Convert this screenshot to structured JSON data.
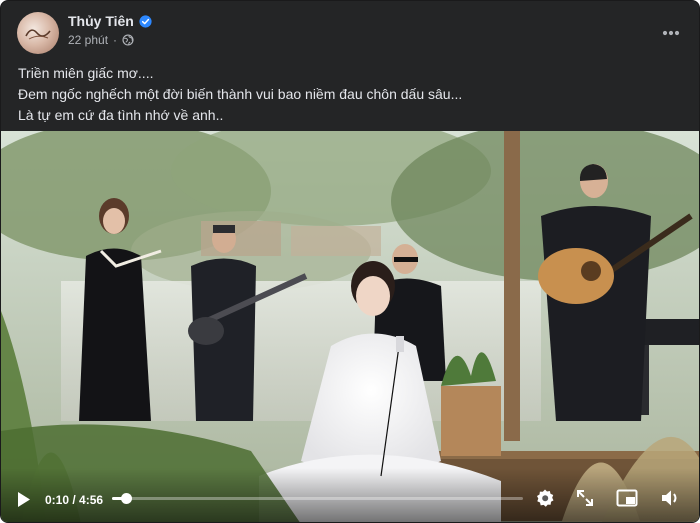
{
  "post": {
    "author": "Thủy Tiên",
    "time": "22 phút",
    "separator": "·",
    "avatar_icon": "avatar-image",
    "text_lines": [
      "Triền miên giấc mơ....",
      "Đem ngốc nghếch một đời biến thành vui bao niềm đau chôn dấu sâu...",
      "Là tự em cứ đa tình nhớ về anh.."
    ]
  },
  "video": {
    "current_time": "0:10",
    "duration": "4:56",
    "time_display": "0:10 / 4:56",
    "progress": 0.034,
    "icons": [
      "play-icon",
      "settings-icon",
      "fullscreen-icon",
      "mini-player-icon",
      "volume-icon"
    ]
  },
  "colors": {
    "card_bg": "#242526",
    "text_primary": "#e4e6eb",
    "text_secondary": "#b0b3b8",
    "verified_blue": "#2d88ff"
  }
}
